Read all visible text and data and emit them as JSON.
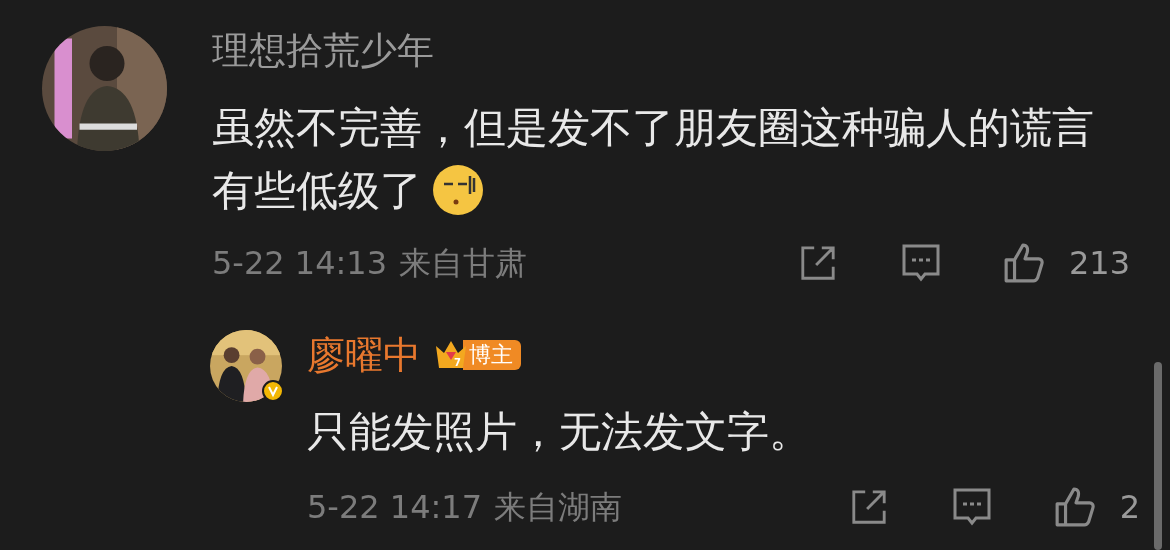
{
  "comments": [
    {
      "author": "理想拾荒少年",
      "kind": "comment",
      "verified": false,
      "body": "虽然不完善，但是发不了朋友圈这种骗人的谎言有些低级了",
      "has_emoji": true,
      "date": "5-22 14:13",
      "location": "来自甘肃",
      "likes": "213"
    },
    {
      "author": "廖曜中",
      "kind": "reply",
      "verified": true,
      "badge": "博主",
      "badge_level": "7",
      "body": "只能发照片，无法发文字。",
      "has_emoji": false,
      "date": "5-22 14:17",
      "location": "来自湖南",
      "likes": "2"
    }
  ]
}
